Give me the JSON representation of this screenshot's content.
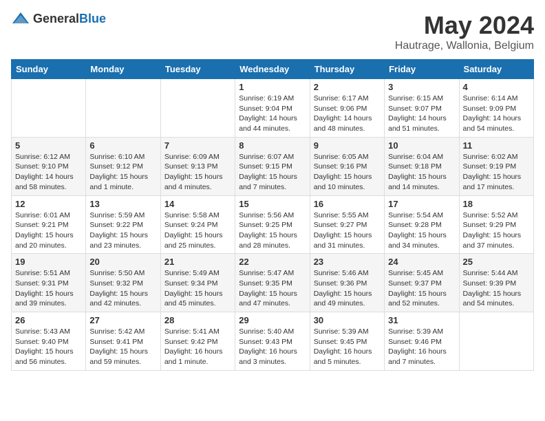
{
  "header": {
    "logo_general": "General",
    "logo_blue": "Blue",
    "month_year": "May 2024",
    "location": "Hautrage, Wallonia, Belgium"
  },
  "days_of_week": [
    "Sunday",
    "Monday",
    "Tuesday",
    "Wednesday",
    "Thursday",
    "Friday",
    "Saturday"
  ],
  "weeks": [
    [
      {
        "day": "",
        "sunrise": "",
        "sunset": "",
        "daylight": ""
      },
      {
        "day": "",
        "sunrise": "",
        "sunset": "",
        "daylight": ""
      },
      {
        "day": "",
        "sunrise": "",
        "sunset": "",
        "daylight": ""
      },
      {
        "day": "1",
        "sunrise": "Sunrise: 6:19 AM",
        "sunset": "Sunset: 9:04 PM",
        "daylight": "Daylight: 14 hours and 44 minutes."
      },
      {
        "day": "2",
        "sunrise": "Sunrise: 6:17 AM",
        "sunset": "Sunset: 9:06 PM",
        "daylight": "Daylight: 14 hours and 48 minutes."
      },
      {
        "day": "3",
        "sunrise": "Sunrise: 6:15 AM",
        "sunset": "Sunset: 9:07 PM",
        "daylight": "Daylight: 14 hours and 51 minutes."
      },
      {
        "day": "4",
        "sunrise": "Sunrise: 6:14 AM",
        "sunset": "Sunset: 9:09 PM",
        "daylight": "Daylight: 14 hours and 54 minutes."
      }
    ],
    [
      {
        "day": "5",
        "sunrise": "Sunrise: 6:12 AM",
        "sunset": "Sunset: 9:10 PM",
        "daylight": "Daylight: 14 hours and 58 minutes."
      },
      {
        "day": "6",
        "sunrise": "Sunrise: 6:10 AM",
        "sunset": "Sunset: 9:12 PM",
        "daylight": "Daylight: 15 hours and 1 minute."
      },
      {
        "day": "7",
        "sunrise": "Sunrise: 6:09 AM",
        "sunset": "Sunset: 9:13 PM",
        "daylight": "Daylight: 15 hours and 4 minutes."
      },
      {
        "day": "8",
        "sunrise": "Sunrise: 6:07 AM",
        "sunset": "Sunset: 9:15 PM",
        "daylight": "Daylight: 15 hours and 7 minutes."
      },
      {
        "day": "9",
        "sunrise": "Sunrise: 6:05 AM",
        "sunset": "Sunset: 9:16 PM",
        "daylight": "Daylight: 15 hours and 10 minutes."
      },
      {
        "day": "10",
        "sunrise": "Sunrise: 6:04 AM",
        "sunset": "Sunset: 9:18 PM",
        "daylight": "Daylight: 15 hours and 14 minutes."
      },
      {
        "day": "11",
        "sunrise": "Sunrise: 6:02 AM",
        "sunset": "Sunset: 9:19 PM",
        "daylight": "Daylight: 15 hours and 17 minutes."
      }
    ],
    [
      {
        "day": "12",
        "sunrise": "Sunrise: 6:01 AM",
        "sunset": "Sunset: 9:21 PM",
        "daylight": "Daylight: 15 hours and 20 minutes."
      },
      {
        "day": "13",
        "sunrise": "Sunrise: 5:59 AM",
        "sunset": "Sunset: 9:22 PM",
        "daylight": "Daylight: 15 hours and 23 minutes."
      },
      {
        "day": "14",
        "sunrise": "Sunrise: 5:58 AM",
        "sunset": "Sunset: 9:24 PM",
        "daylight": "Daylight: 15 hours and 25 minutes."
      },
      {
        "day": "15",
        "sunrise": "Sunrise: 5:56 AM",
        "sunset": "Sunset: 9:25 PM",
        "daylight": "Daylight: 15 hours and 28 minutes."
      },
      {
        "day": "16",
        "sunrise": "Sunrise: 5:55 AM",
        "sunset": "Sunset: 9:27 PM",
        "daylight": "Daylight: 15 hours and 31 minutes."
      },
      {
        "day": "17",
        "sunrise": "Sunrise: 5:54 AM",
        "sunset": "Sunset: 9:28 PM",
        "daylight": "Daylight: 15 hours and 34 minutes."
      },
      {
        "day": "18",
        "sunrise": "Sunrise: 5:52 AM",
        "sunset": "Sunset: 9:29 PM",
        "daylight": "Daylight: 15 hours and 37 minutes."
      }
    ],
    [
      {
        "day": "19",
        "sunrise": "Sunrise: 5:51 AM",
        "sunset": "Sunset: 9:31 PM",
        "daylight": "Daylight: 15 hours and 39 minutes."
      },
      {
        "day": "20",
        "sunrise": "Sunrise: 5:50 AM",
        "sunset": "Sunset: 9:32 PM",
        "daylight": "Daylight: 15 hours and 42 minutes."
      },
      {
        "day": "21",
        "sunrise": "Sunrise: 5:49 AM",
        "sunset": "Sunset: 9:34 PM",
        "daylight": "Daylight: 15 hours and 45 minutes."
      },
      {
        "day": "22",
        "sunrise": "Sunrise: 5:47 AM",
        "sunset": "Sunset: 9:35 PM",
        "daylight": "Daylight: 15 hours and 47 minutes."
      },
      {
        "day": "23",
        "sunrise": "Sunrise: 5:46 AM",
        "sunset": "Sunset: 9:36 PM",
        "daylight": "Daylight: 15 hours and 49 minutes."
      },
      {
        "day": "24",
        "sunrise": "Sunrise: 5:45 AM",
        "sunset": "Sunset: 9:37 PM",
        "daylight": "Daylight: 15 hours and 52 minutes."
      },
      {
        "day": "25",
        "sunrise": "Sunrise: 5:44 AM",
        "sunset": "Sunset: 9:39 PM",
        "daylight": "Daylight: 15 hours and 54 minutes."
      }
    ],
    [
      {
        "day": "26",
        "sunrise": "Sunrise: 5:43 AM",
        "sunset": "Sunset: 9:40 PM",
        "daylight": "Daylight: 15 hours and 56 minutes."
      },
      {
        "day": "27",
        "sunrise": "Sunrise: 5:42 AM",
        "sunset": "Sunset: 9:41 PM",
        "daylight": "Daylight: 15 hours and 59 minutes."
      },
      {
        "day": "28",
        "sunrise": "Sunrise: 5:41 AM",
        "sunset": "Sunset: 9:42 PM",
        "daylight": "Daylight: 16 hours and 1 minute."
      },
      {
        "day": "29",
        "sunrise": "Sunrise: 5:40 AM",
        "sunset": "Sunset: 9:43 PM",
        "daylight": "Daylight: 16 hours and 3 minutes."
      },
      {
        "day": "30",
        "sunrise": "Sunrise: 5:39 AM",
        "sunset": "Sunset: 9:45 PM",
        "daylight": "Daylight: 16 hours and 5 minutes."
      },
      {
        "day": "31",
        "sunrise": "Sunrise: 5:39 AM",
        "sunset": "Sunset: 9:46 PM",
        "daylight": "Daylight: 16 hours and 7 minutes."
      },
      {
        "day": "",
        "sunrise": "",
        "sunset": "",
        "daylight": ""
      }
    ]
  ]
}
